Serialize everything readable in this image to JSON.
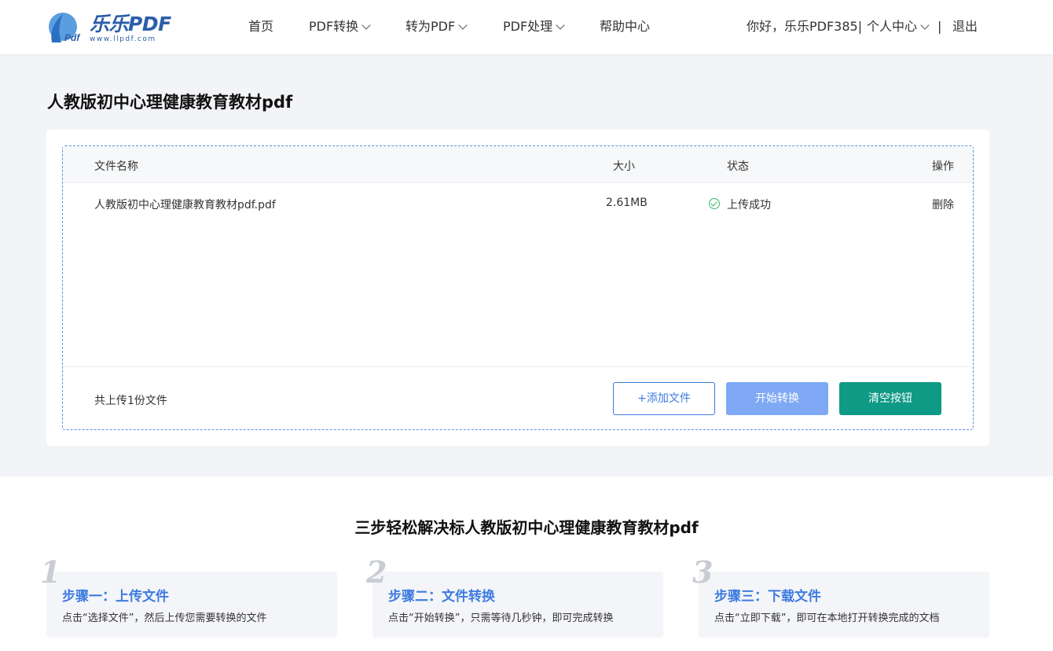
{
  "header": {
    "logo_text": "乐乐PDF",
    "logo_url": "www.llpdf.com",
    "nav": [
      {
        "label": "首页",
        "has_dropdown": false
      },
      {
        "label": "PDF转换",
        "has_dropdown": true
      },
      {
        "label": "转为PDF",
        "has_dropdown": true
      },
      {
        "label": "PDF处理",
        "has_dropdown": true
      },
      {
        "label": "帮助中心",
        "has_dropdown": false
      }
    ],
    "greeting": "你好，乐乐PDF385|",
    "user_center": "个人中心",
    "separator": "|",
    "logout": "退出"
  },
  "page_title": "人教版初中心理健康教育教材pdf",
  "table": {
    "headers": {
      "name": "文件名称",
      "size": "大小",
      "status": "状态",
      "action": "操作"
    },
    "rows": [
      {
        "name": "人教版初中心理健康教育教材pdf.pdf",
        "size": "2.61MB",
        "status": "上传成功",
        "action": "删除"
      }
    ]
  },
  "footer": {
    "count_text": "共上传1份文件",
    "add_label": "+添加文件",
    "start_label": "开始转换",
    "clear_label": "清空按钮"
  },
  "steps_section": {
    "title": "三步轻松解决标人教版初中心理健康教育教材pdf",
    "steps": [
      {
        "num": "1",
        "title": "步骤一：上传文件",
        "desc": "点击“选择文件”，然后上传您需要转换的文件"
      },
      {
        "num": "2",
        "title": "步骤二：文件转换",
        "desc": "点击“开始转换”，只需等待几秒钟，即可完成转换"
      },
      {
        "num": "3",
        "title": "步骤三：下载文件",
        "desc": "点击“立即下载”，即可在本地打开转换完成的文档"
      }
    ]
  },
  "colors": {
    "accent": "#3d7be0",
    "success": "#3bb36a",
    "teal": "#0e9a85",
    "start_btn": "#7fa9f5"
  }
}
